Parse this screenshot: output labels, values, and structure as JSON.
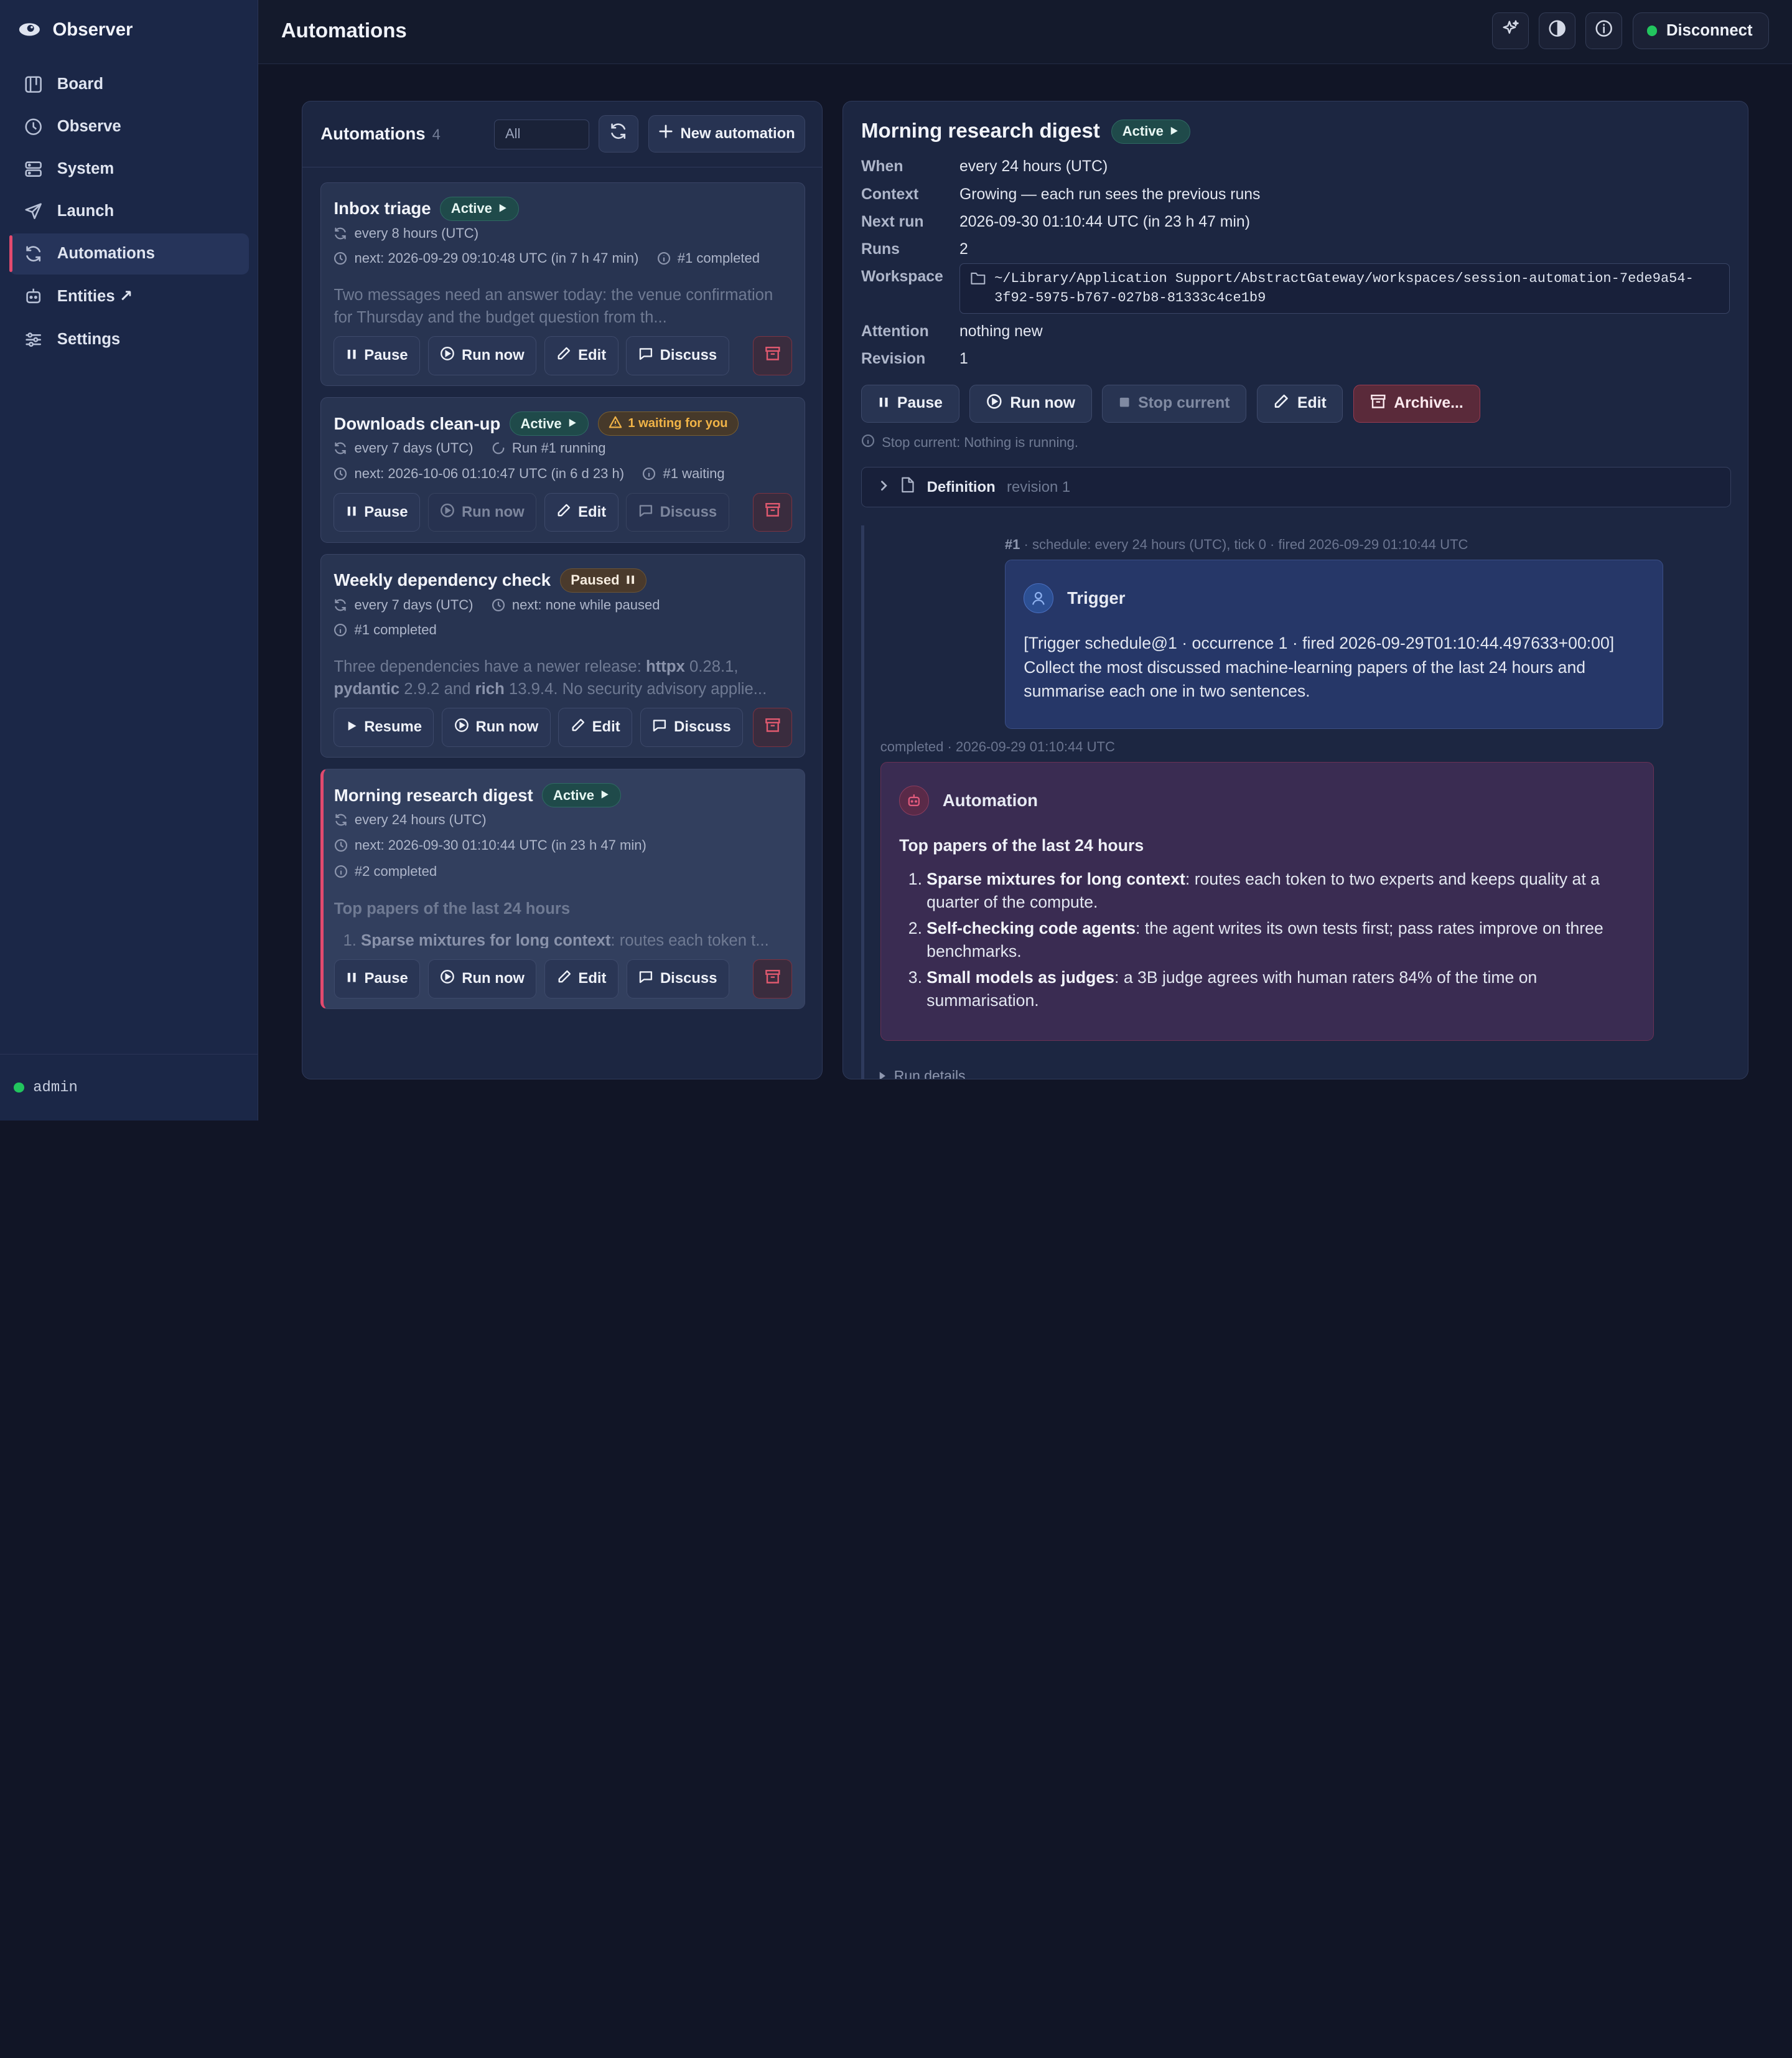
{
  "brand": {
    "name": "Observer"
  },
  "nav": [
    {
      "label": "Board",
      "icon": "board-icon"
    },
    {
      "label": "Observe",
      "icon": "clock-icon"
    },
    {
      "label": "System",
      "icon": "server-icon"
    },
    {
      "label": "Launch",
      "icon": "send-icon"
    },
    {
      "label": "Automations",
      "icon": "refresh-icon",
      "active": true
    },
    {
      "label": "Entities ↗",
      "icon": "robot-icon"
    },
    {
      "label": "Settings",
      "icon": "sliders-icon"
    }
  ],
  "user": {
    "name": "admin"
  },
  "header": {
    "title": "Automations",
    "disconnect_label": "Disconnect"
  },
  "list": {
    "title": "Automations",
    "count": "4",
    "filter_value": "All",
    "new_label": "New automation",
    "cards": [
      {
        "title": "Inbox triage",
        "status": "Active",
        "schedule": "every 8 hours (UTC)",
        "next": "next: 2026-09-29 09:10:48 UTC (in 7 h 47 min)",
        "runs": "#1 completed",
        "preview": "Two messages need an answer today: the venue confirmation for Thursday and the budget question from th...",
        "actions": [
          "Pause",
          "Run now",
          "Edit",
          "Discuss"
        ]
      },
      {
        "title": "Downloads clean-up",
        "status": "Active",
        "warning": "1 waiting for you",
        "schedule": "every 7 days (UTC)",
        "running": "Run #1 running",
        "next": "next: 2026-10-06 01:10:47 UTC (in 6 d 23 h)",
        "runs": "#1 waiting",
        "actions": [
          "Pause",
          "Run now",
          "Edit",
          "Discuss"
        ]
      },
      {
        "title": "Weekly dependency check",
        "status": "Paused",
        "schedule": "every 7 days (UTC)",
        "next": "next: none while paused",
        "runs": "#1 completed",
        "preview_a": "Three dependencies have a newer release: ",
        "pkg1": "httpx",
        "preview_b": " 0.28.1, ",
        "pkg2": "pydantic",
        "preview_c": " 2.9.2 and ",
        "pkg3": "rich",
        "preview_d": " 13.9.4. No security advisory applie...",
        "actions": [
          "Resume",
          "Run now",
          "Edit",
          "Discuss"
        ]
      },
      {
        "title": "Morning research digest",
        "status": "Active",
        "schedule": "every 24 hours (UTC)",
        "next": "next: 2026-09-30 01:10:44 UTC (in 23 h 47 min)",
        "runs": "#2 completed",
        "preview_heading": "Top papers of the last 24 hours",
        "preview_item_num": "1.",
        "preview_item_bold": "Sparse mixtures for long context",
        "preview_item_rest": ": routes each token t...",
        "actions": [
          "Pause",
          "Run now",
          "Edit",
          "Discuss"
        ]
      }
    ]
  },
  "detail": {
    "title": "Morning research digest",
    "status": "Active",
    "fields": {
      "when_label": "When",
      "when": "every 24 hours (UTC)",
      "context_label": "Context",
      "context": "Growing — each run sees the previous runs",
      "next_label": "Next run",
      "next": "2026-09-30 01:10:44 UTC (in 23 h 47 min)",
      "runs_label": "Runs",
      "runs": "2",
      "workspace_label": "Workspace",
      "workspace_line1": "~/Library/Application Support/AbstractGateway/workspaces/session-automation-7ede9a54-",
      "workspace_line2": "3f92-5975-b767-027b8-81333c4ce1b9",
      "attention_label": "Attention",
      "attention": "nothing new",
      "revision_label": "Revision",
      "revision": "1"
    },
    "actions": {
      "pause": "Pause",
      "run_now": "Run now",
      "stop": "Stop current",
      "edit": "Edit",
      "archive": "Archive..."
    },
    "hint": "Stop current: Nothing is running.",
    "definition": {
      "label": "Definition",
      "revision": "revision 1"
    },
    "trigger": {
      "meta_num": "#1",
      "meta_rest": " · schedule: every 24 hours (UTC), tick 0 · fired 2026-09-29 01:10:44 UTC",
      "author": "Trigger",
      "text": "[Trigger schedule@1 · occurrence 1 · fired 2026-09-29T01:10:44.497633+00:00] Collect the most discussed machine-learning papers of the last 24 hours and summarise each one in two sentences."
    },
    "result": {
      "meta": "completed · 2026-09-29 01:10:44 UTC",
      "author": "Automation",
      "heading": "Top papers of the last 24 hours",
      "items": [
        {
          "num": "1.",
          "bold": "Sparse mixtures for long context",
          "rest": ": routes each token to two experts and keeps quality at a quarter of the compute."
        },
        {
          "num": "2.",
          "bold": "Self-checking code agents",
          "rest": ": the agent writes its own tests first; pass rates improve on three benchmarks."
        },
        {
          "num": "3.",
          "bold": "Small models as judges",
          "rest": ": a 3B judge agrees with human raters 84% of the time on summarisation."
        }
      ],
      "run_details": "Run details"
    }
  }
}
